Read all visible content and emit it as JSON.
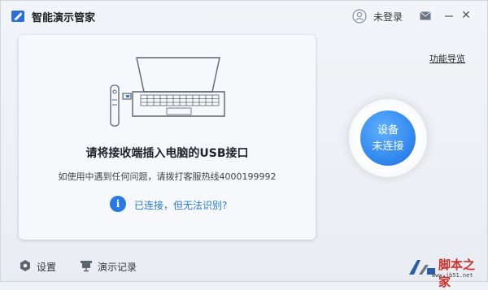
{
  "titlebar": {
    "app_title": "智能演示管家",
    "login_text": "未登录"
  },
  "card": {
    "heading": "请将接收端插入电脑的USB接口",
    "help_text": "如使用中遇到任何问题，请拨打客服热线4000199992",
    "status_link": "已连接，但无法识别?"
  },
  "right": {
    "guide_link": "功能导览",
    "device_status_line1": "设备",
    "device_status_line2": "未连接"
  },
  "bottom": {
    "settings_label": "设置",
    "records_label": "演示记录"
  },
  "watermark": {
    "text_big": "脚本之家",
    "text_small": "www.jb51.net"
  },
  "colors": {
    "accent": "#2879e6",
    "button": "#2d84ec",
    "watermark": "#c9312a"
  }
}
